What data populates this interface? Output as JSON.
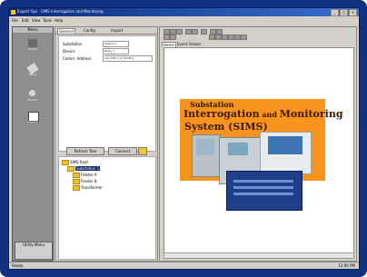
{
  "window": {
    "title": "Expert Ops - SIMS Interrogation and Monitoring",
    "controls": [
      "_",
      "□",
      "×"
    ]
  },
  "menu": {
    "items": [
      "File",
      "Edit",
      "View",
      "Tools",
      "Help"
    ]
  },
  "leftbar": {
    "header": "Menu",
    "buttons": [
      {
        "label": "Station",
        "icon": "station-icon",
        "color": "#6b6b6b"
      },
      {
        "label": "Setup",
        "icon": "setup-icon",
        "color": "#d8d8d8"
      },
      {
        "label": "Monitor",
        "icon": "monitor-icon",
        "color": "#d8d8d8"
      },
      {
        "label": "Report",
        "icon": "report-icon",
        "color": "#ffffff"
      }
    ],
    "footer": "Utility Menu"
  },
  "midpanel": {
    "tabs": [
      "General",
      "Config",
      "Import"
    ],
    "properties": [
      {
        "label": "Substation",
        "value": "Station A"
      },
      {
        "label": "Device",
        "value": "Relay 1"
      },
      {
        "label": "Comm. Address",
        "value": "192.168.1.10 (COM1)"
      }
    ],
    "buttons": [
      "Refresh Tree",
      "Connect"
    ],
    "tree": [
      {
        "label": "SIMS Root",
        "level": 0
      },
      {
        "label": "Substation 1",
        "level": 1,
        "selected": true
      },
      {
        "label": "Feeder A",
        "level": 2
      },
      {
        "label": "Feeder B",
        "level": 2
      },
      {
        "label": "Transformer",
        "level": 2
      }
    ]
  },
  "rightpanel": {
    "tabs": [
      "Home",
      "Event Viewer"
    ],
    "banner": {
      "subtitle": "Substation",
      "title_line1_a": "Interrogation",
      "title_line1_b": " and ",
      "title_line1_c": "Monitoring",
      "title_line2": "System (SIMS)"
    }
  },
  "status": {
    "left": "Ready",
    "right": "12:00 PM"
  },
  "colors": {
    "frame": "#12317f",
    "banner": "#f7941d",
    "title_bar": "#0a2a7c"
  }
}
